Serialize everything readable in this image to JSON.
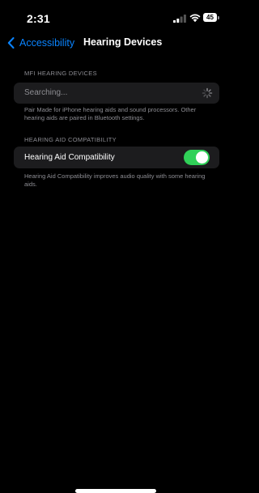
{
  "status_bar": {
    "time": "2:31",
    "battery_level": "45"
  },
  "nav": {
    "back_label": "Accessibility",
    "title": "Hearing Devices"
  },
  "mfi_section": {
    "header": "MFI HEARING DEVICES",
    "searching_label": "Searching...",
    "footer": "Pair Made for iPhone hearing aids and sound processors. Other hearing aids are paired in Bluetooth settings."
  },
  "hac_section": {
    "header": "HEARING AID COMPATIBILITY",
    "toggle_label": "Hearing Aid Compatibility",
    "toggle_on": true,
    "footer": "Hearing Aid Compatibility improves audio quality with some hearing aids."
  },
  "colors": {
    "accent": "#0a84ff",
    "toggle_on": "#30d158",
    "cell_bg": "#1c1c1e",
    "secondary_text": "#8d8d93"
  }
}
